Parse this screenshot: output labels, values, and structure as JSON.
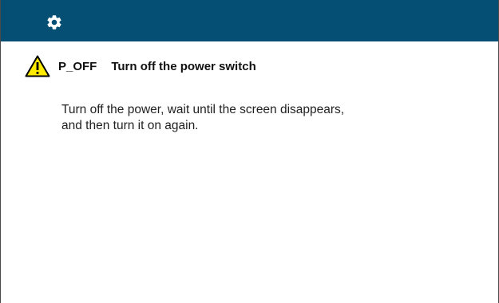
{
  "header": {
    "settings_icon": "gear-icon",
    "background_color": "#044f73"
  },
  "message": {
    "icon": "warning-icon",
    "icon_color": "#ffeb00",
    "code": "P_OFF",
    "title": "Turn off the power switch",
    "body_lines": [
      "Turn off the power, wait until the screen disappears,",
      "and then turn it on again."
    ]
  }
}
